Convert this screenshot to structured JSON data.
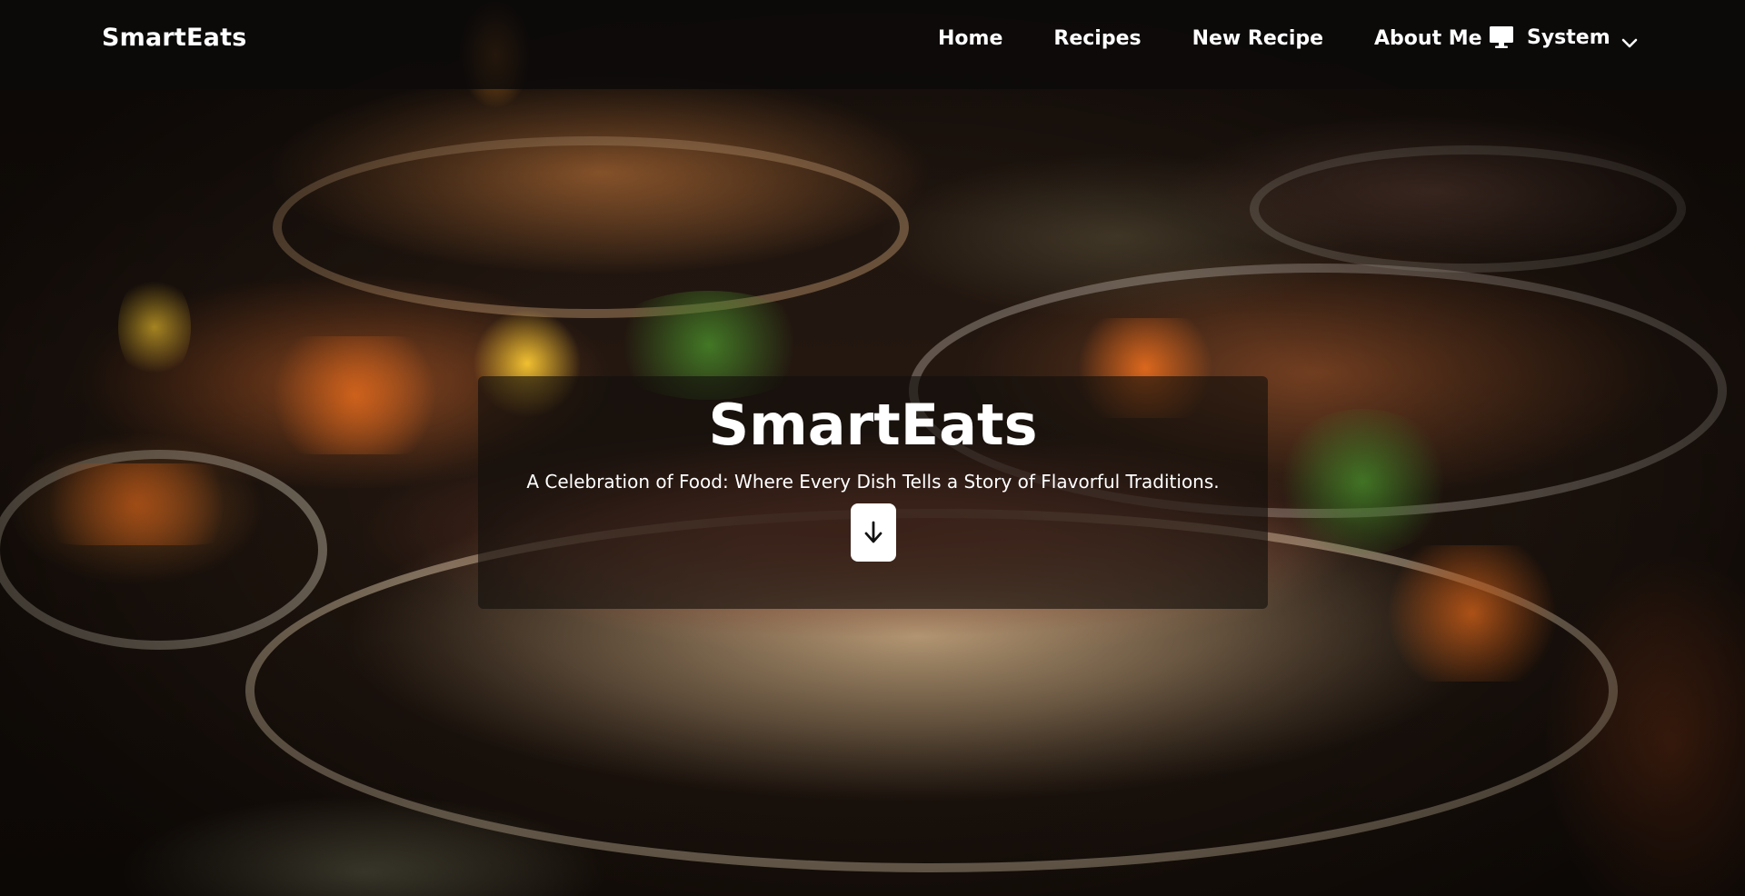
{
  "navbar": {
    "brand": "SmartEats",
    "links": [
      {
        "label": "Home"
      },
      {
        "label": "Recipes"
      },
      {
        "label": "New Recipe"
      },
      {
        "label": "About Me"
      }
    ],
    "theme": {
      "icon": "monitor-icon",
      "label": "System",
      "dropdown_icon": "chevron-down-icon"
    }
  },
  "hero": {
    "title": "SmartEats",
    "subtitle": "A Celebration of Food: Where Every Dish Tells a Story of Flavorful Traditions.",
    "scroll_icon": "arrow-down-icon"
  },
  "colors": {
    "navbar_bg": "#0c0a0a",
    "text": "#ffffff",
    "button_bg": "#ffffff"
  }
}
